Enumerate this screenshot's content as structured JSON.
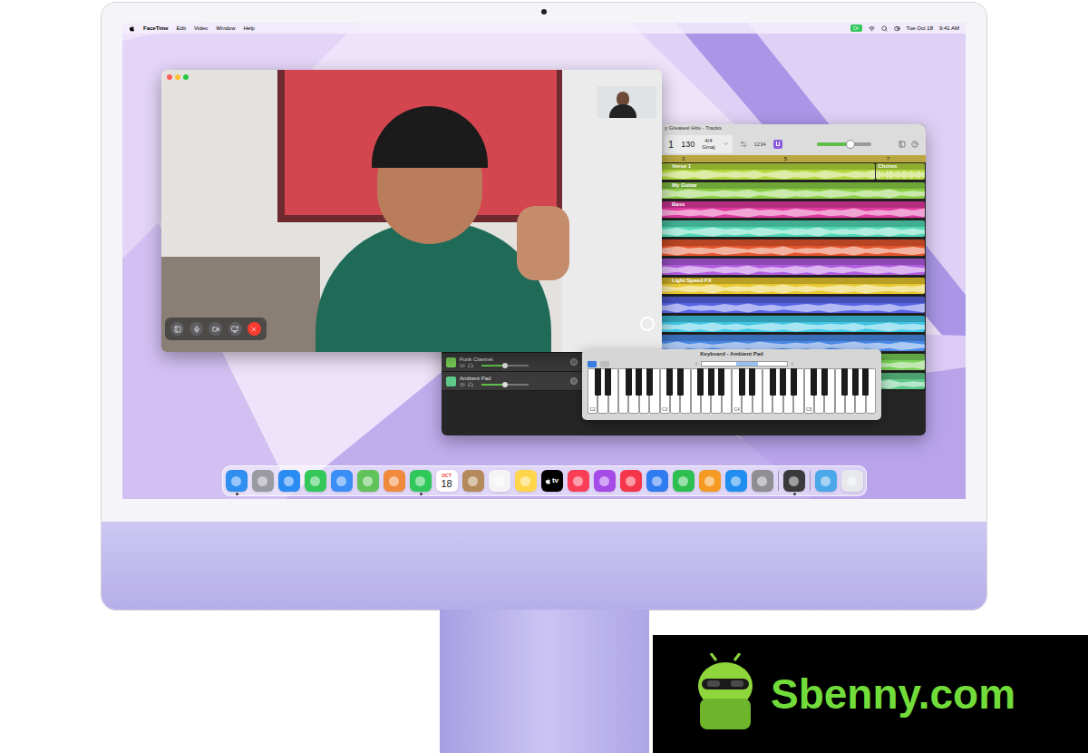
{
  "menu_bar": {
    "app": "FaceTime",
    "menus": [
      "Edit",
      "Video",
      "Window",
      "Help"
    ],
    "date": "Tue Oct 18",
    "time": "9:41 AM"
  },
  "facetime": {
    "controls": [
      {
        "color": "#5f5f63"
      },
      {
        "color": "#5f5f63"
      },
      {
        "color": "#5f5f63"
      },
      {
        "color": "#5f5f63"
      },
      {
        "color": "#ff3b30"
      }
    ]
  },
  "garageband": {
    "title": "y Greatest Hits - Tracks",
    "lcd": {
      "bar": "1",
      "tempo": "130",
      "signature": "4/4",
      "key": "Gmaj"
    },
    "count_in": "1234",
    "master_volume": {
      "level": 0.62
    },
    "ruler": [
      "3",
      "5",
      "7"
    ],
    "tracks": [
      {
        "color": "#b3d83c",
        "regions": [
          "Verse 1",
          "Chorus"
        ]
      },
      {
        "color": "#8bcf45",
        "regions": [
          "My Guitar"
        ]
      },
      {
        "color": "#e0389f",
        "regions": [
          "Bass"
        ]
      },
      {
        "color": "#52d9b6",
        "regions": [
          ""
        ]
      },
      {
        "color": "#e5562c",
        "regions": [
          ""
        ]
      },
      {
        "color": "#b15be0",
        "regions": [
          ""
        ]
      },
      {
        "color": "#e8c82e",
        "regions": [
          "Light Speed FX"
        ]
      },
      {
        "color": "#5663e6",
        "regions": [
          ""
        ]
      },
      {
        "color": "#3fc6e3",
        "regions": [
          ""
        ]
      },
      {
        "color": "#4a8ae8",
        "regions": [
          ""
        ]
      },
      {
        "color": "#79cf57",
        "regions": [
          ""
        ],
        "header": {
          "name": "Funk Clavinet",
          "level": 0.5
        }
      },
      {
        "color": "#5fc98a",
        "regions": [
          ""
        ],
        "header": {
          "name": "Ambient Pad",
          "level": 0.5
        }
      }
    ]
  },
  "keyboard": {
    "title": "Keyboard - Ambient Pad",
    "octaves": [
      "C2",
      "C3",
      "C4",
      "C5"
    ]
  },
  "dock": {
    "groups": [
      [
        {
          "kind": "app",
          "color": "#2f8ef0",
          "running": true
        },
        {
          "kind": "app",
          "color": "#9a9aa2",
          "running": false
        },
        {
          "kind": "app",
          "color": "#2a8bf2",
          "running": false
        },
        {
          "kind": "app",
          "color": "#34c759",
          "running": false
        },
        {
          "kind": "app",
          "color": "#3b8ef5",
          "running": false
        },
        {
          "kind": "app",
          "color": "#5fc35a",
          "running": false
        },
        {
          "kind": "app",
          "color": "#f08a3c",
          "running": false
        },
        {
          "kind": "app",
          "color": "#30c85a",
          "running": true
        },
        {
          "kind": "calendar",
          "month": "OCT",
          "day": "18",
          "running": false
        },
        {
          "kind": "app",
          "color": "#b58a5a",
          "running": false
        },
        {
          "kind": "app",
          "color": "#f4f4f6",
          "running": false
        },
        {
          "kind": "app",
          "color": "#ffd54a",
          "running": false
        },
        {
          "kind": "tv",
          "label": "tv",
          "running": false
        },
        {
          "kind": "app",
          "color": "#fa3e56",
          "running": false
        },
        {
          "kind": "app",
          "color": "#a64ae8",
          "running": false
        },
        {
          "kind": "app",
          "color": "#f5364a",
          "running": false
        },
        {
          "kind": "app",
          "color": "#2f7bf0",
          "running": false
        },
        {
          "kind": "app",
          "color": "#2dbf4f",
          "running": false
        },
        {
          "kind": "app",
          "color": "#f59a23",
          "running": false
        },
        {
          "kind": "app",
          "color": "#1f8ef0",
          "running": false
        },
        {
          "kind": "app",
          "color": "#8e8e93",
          "running": false
        }
      ],
      [
        {
          "kind": "app",
          "color": "#3a3a3c",
          "running": true
        }
      ],
      [
        {
          "kind": "app",
          "color": "#4aa8e8",
          "running": false
        },
        {
          "kind": "app",
          "color": "#e6e8ec",
          "running": false
        }
      ]
    ]
  },
  "watermark": {
    "text": "Sbenny.com"
  }
}
